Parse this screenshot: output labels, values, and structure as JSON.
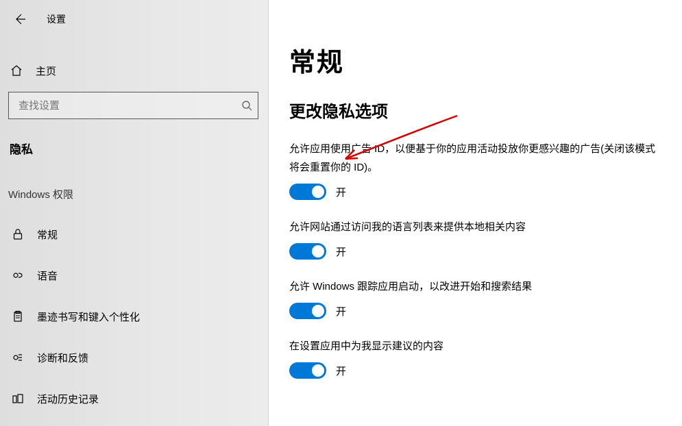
{
  "window": {
    "title": "设置"
  },
  "sidebar": {
    "home": "主页",
    "search_placeholder": "查找设置",
    "section": "隐私",
    "group": "Windows 权限",
    "items": [
      {
        "label": "常规"
      },
      {
        "label": "语音"
      },
      {
        "label": "墨迹书写和键入个性化"
      },
      {
        "label": "诊断和反馈"
      },
      {
        "label": "活动历史记录"
      }
    ]
  },
  "main": {
    "title": "常规",
    "subtitle": "更改隐私选项",
    "settings": [
      {
        "desc": "允许应用使用广告 ID，以便基于你的应用活动投放你更感兴趣的广告(关闭该模式将会重置你的 ID)。",
        "state": "开"
      },
      {
        "desc": "允许网站通过访问我的语言列表来提供本地相关内容",
        "state": "开"
      },
      {
        "desc": "允许 Windows 跟踪应用启动，以改进开始和搜索结果",
        "state": "开"
      },
      {
        "desc": "在设置应用中为我显示建议的内容",
        "state": "开"
      }
    ]
  }
}
